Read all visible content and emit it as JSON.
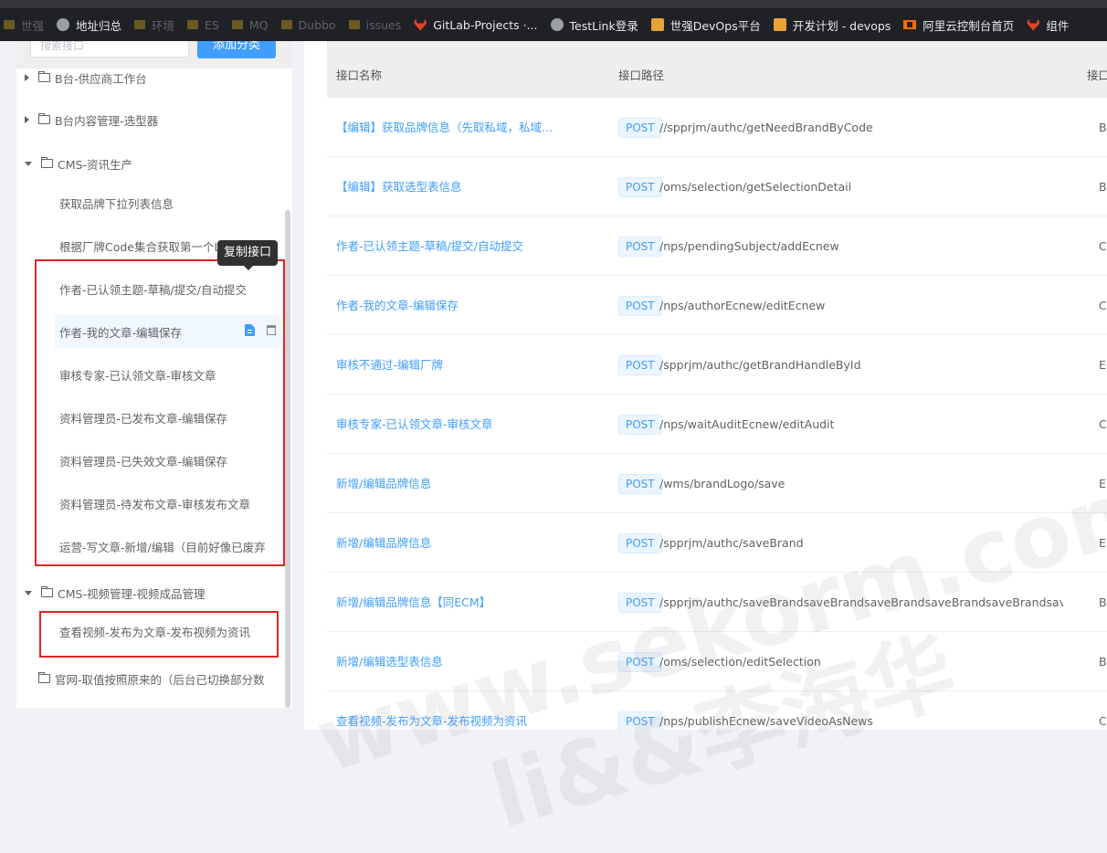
{
  "bookmarks": [
    {
      "label": "世强",
      "icon": "folder-icon",
      "dim": true
    },
    {
      "label": "地址归总",
      "icon": "globe-icon",
      "dim": false
    },
    {
      "label": "环境",
      "icon": "folder-icon",
      "dim": true
    },
    {
      "label": "ES",
      "icon": "folder-icon",
      "dim": true
    },
    {
      "label": "MQ",
      "icon": "folder-icon",
      "dim": true
    },
    {
      "label": "Dubbo",
      "icon": "folder-icon",
      "dim": true
    },
    {
      "label": "issues",
      "icon": "folder-icon",
      "dim": true
    },
    {
      "label": "GitLab-Projects ·...",
      "icon": "gitlab-icon",
      "dim": false
    },
    {
      "label": "TestLink登录",
      "icon": "globe-icon",
      "dim": false
    },
    {
      "label": "世强DevOps平台",
      "icon": "devops-icon",
      "dim": false
    },
    {
      "label": "开发计划 - devops",
      "icon": "devops-icon",
      "dim": false
    },
    {
      "label": "阿里云控制台首页",
      "icon": "aliyun-icon",
      "dim": false
    },
    {
      "label": "组件",
      "icon": "gitlab-icon",
      "dim": false
    }
  ],
  "sidebar": {
    "search_placeholder": "搜索接口",
    "add_category_label": "添加分类",
    "categories": [
      {
        "label": "B台-供应商工作台",
        "expanded": false
      },
      {
        "label": "B台内容管理-选型器",
        "expanded": false
      },
      {
        "label": "CMS-资讯生产",
        "expanded": true
      },
      {
        "label": "CMS-视频管理-视频成品管理",
        "expanded": true
      },
      {
        "label": "官网-取值按照原来的（后台已切换部分数",
        "expanded": null
      }
    ],
    "cms_news_items": [
      {
        "label": "获取品牌下拉列表信息"
      },
      {
        "label": "根据厂牌Code集合获取第一个Logo的url"
      },
      {
        "label": "作者-已认领主题-草稿/提交/自动提交"
      },
      {
        "label": "作者-我的文章-编辑保存",
        "active": true
      },
      {
        "label": "审核专家-已认领文章-审核文章"
      },
      {
        "label": "资料管理员-已发布文章-编辑保存"
      },
      {
        "label": "资料管理员-已失效文章-编辑保存"
      },
      {
        "label": "资料管理员-待发布文章-审核发布文章"
      },
      {
        "label": "运营-写文章-新增/编辑（目前好像已废弃"
      }
    ],
    "cms_video_items": [
      {
        "label": "查看视频-发布为文章-发布视频为资讯"
      }
    ],
    "tooltip": "复制接口"
  },
  "table": {
    "headers": {
      "name": "接口名称",
      "path": "接口路径",
      "third": "接口"
    },
    "rows": [
      {
        "name": "【编辑】获取品牌信息（先取私域，私域...",
        "method": "POST",
        "path": "//spprjm/authc/getNeedBrandByCode",
        "third": "B"
      },
      {
        "name": "【编辑】获取选型表信息",
        "method": "POST",
        "path": "/oms/selection/getSelectionDetail",
        "third": "B"
      },
      {
        "name": "作者-已认领主题-草稿/提交/自动提交",
        "method": "POST",
        "path": "/nps/pendingSubject/addEcnew",
        "third": "C"
      },
      {
        "name": "作者-我的文章-编辑保存",
        "method": "POST",
        "path": "/nps/authorEcnew/editEcnew",
        "third": "C"
      },
      {
        "name": "审核不通过-编辑厂牌",
        "method": "POST",
        "path": "/spprjm/authc/getBrandHandleById",
        "third": "E"
      },
      {
        "name": "审核专家-已认领文章-审核文章",
        "method": "POST",
        "path": "/nps/waitAuditEcnew/editAudit",
        "third": "C"
      },
      {
        "name": "新增/编辑品牌信息",
        "method": "POST",
        "path": "/wms/brandLogo/save",
        "third": "E"
      },
      {
        "name": "新增/编辑品牌信息",
        "method": "POST",
        "path": "/spprjm/authc/saveBrand",
        "third": "E"
      },
      {
        "name": "新增/编辑品牌信息【同ECM】",
        "method": "POST",
        "path": "/spprjm/authc/saveBrandsaveBrandsaveBrandsaveBrandsaveBrandsaveBran...",
        "third": "B"
      },
      {
        "name": "新增/编辑选型表信息",
        "method": "POST",
        "path": "/oms/selection/editSelection",
        "third": "B"
      },
      {
        "name": "查看视频-发布为文章-发布视频为资讯",
        "method": "POST",
        "path": "/nps/publishEcnew/saveVideoAsNews",
        "third": "C"
      }
    ]
  },
  "watermark": {
    "line1": "www.sekorm.com",
    "line2": "li&&李海华"
  },
  "colors": {
    "accent": "#409eff",
    "highlight_box": "#e02424",
    "bookmark_bar": "#202124"
  }
}
